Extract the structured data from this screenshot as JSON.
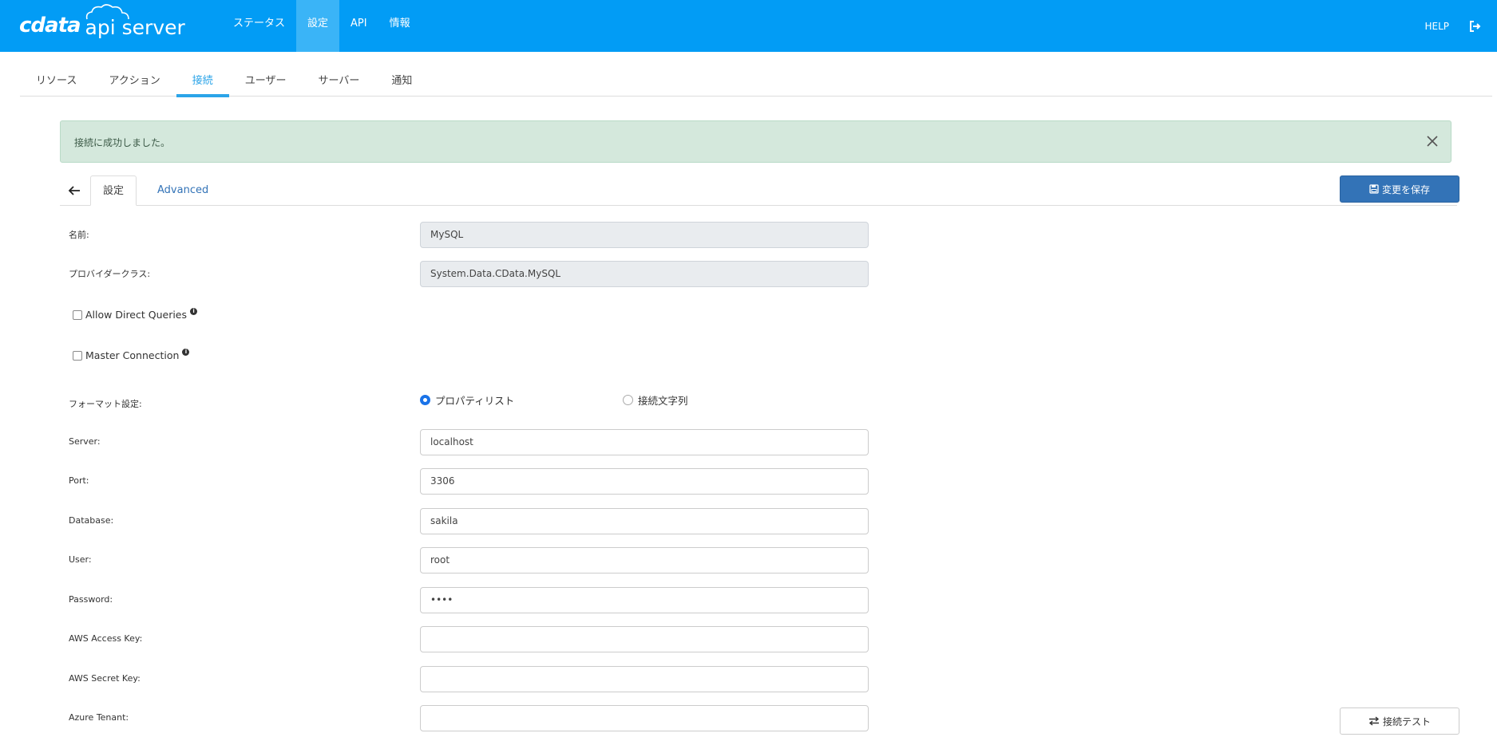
{
  "header": {
    "logo_brand": "cdata",
    "logo_product": "api server",
    "nav": [
      {
        "label": "ステータス"
      },
      {
        "label": "設定"
      },
      {
        "label": "API"
      },
      {
        "label": "情報"
      }
    ],
    "help_label": "HELP",
    "logout_icon": "logout-icon",
    "color": "#029cf5"
  },
  "section_tabs": [
    {
      "label": "リソース"
    },
    {
      "label": "アクション"
    },
    {
      "label": "接続"
    },
    {
      "label": "ユーザー"
    },
    {
      "label": "サーバー"
    },
    {
      "label": "通知"
    }
  ],
  "active_section_tab": "接続",
  "alert": {
    "message": "接続に成功しました。",
    "close_icon": "close-icon"
  },
  "inner_tabs": {
    "settings": "設定",
    "advanced": "Advanced"
  },
  "save_button": {
    "label": "変更を保存",
    "icon": "save-icon"
  },
  "form": {
    "name": {
      "label": "名前:",
      "value": "MySQL"
    },
    "provider": {
      "label": "プロバイダークラス:",
      "value": "System.Data.CData.MySQL"
    },
    "allow_direct": {
      "label": "Allow Direct Queries"
    },
    "master_conn": {
      "label": "Master Connection"
    },
    "format": {
      "label": "フォーマット設定:",
      "options": [
        {
          "label": "プロパティリスト",
          "selected": true
        },
        {
          "label": "接続文字列",
          "selected": false
        }
      ]
    },
    "server": {
      "label": "Server:",
      "value": "localhost"
    },
    "port": {
      "label": "Port:",
      "value": "3306"
    },
    "database": {
      "label": "Database:",
      "value": "sakila"
    },
    "user": {
      "label": "User:",
      "value": "root"
    },
    "password": {
      "label": "Password:",
      "value": "••••"
    },
    "aws_access": {
      "label": "AWS Access Key:",
      "value": ""
    },
    "aws_secret": {
      "label": "AWS Secret Key:",
      "value": ""
    },
    "azure_tenant": {
      "label": "Azure Tenant:",
      "value": ""
    }
  },
  "test_button": {
    "label": "接続テスト",
    "icon": "exchange-icon"
  }
}
